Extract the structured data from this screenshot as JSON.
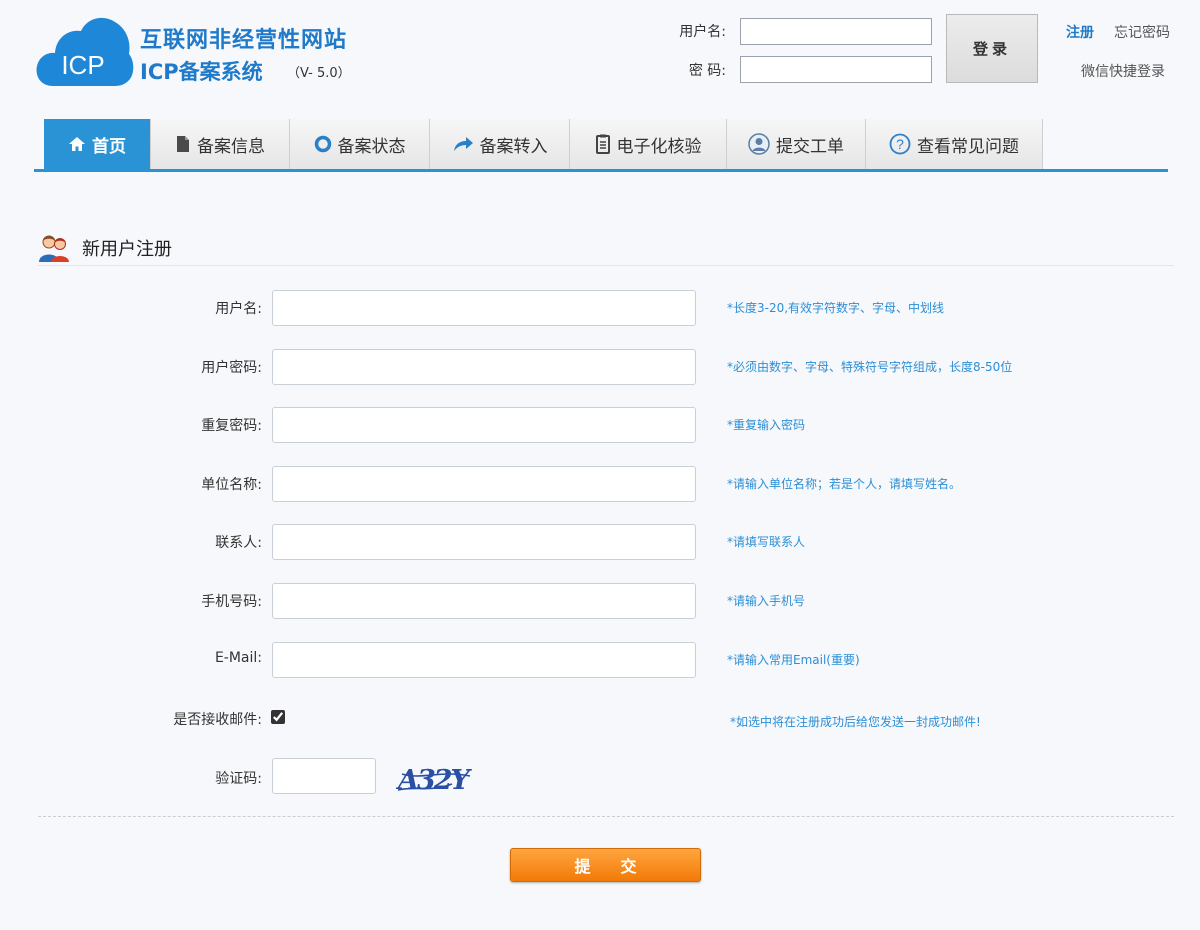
{
  "header": {
    "logo_text": "ICP",
    "title": "互联网非经营性网站",
    "subtitle": "ICP备案系统",
    "version": "（V- 5.0）",
    "username_label": "用户名:",
    "password_label": "密 码:",
    "username_value": "",
    "password_value": "",
    "login_label": "登录",
    "register_label": "注册",
    "forgot_label": "忘记密码",
    "wechat_label": "微信快捷登录"
  },
  "nav": {
    "tabs": [
      {
        "label": "首页",
        "icon": "home-icon",
        "active": true
      },
      {
        "label": "备案信息",
        "icon": "document-icon",
        "active": false
      },
      {
        "label": "备案状态",
        "icon": "ring-icon",
        "active": false
      },
      {
        "label": "备案转入",
        "icon": "arrow-right-icon",
        "active": false
      },
      {
        "label": "电子化核验",
        "icon": "clipboard-icon",
        "active": false
      },
      {
        "label": "提交工单",
        "icon": "user-icon",
        "active": false
      },
      {
        "label": "查看常见问题",
        "icon": "question-icon",
        "active": false
      }
    ]
  },
  "form": {
    "title": "新用户注册",
    "fields": [
      {
        "label": "用户名:",
        "value": "",
        "hint": "*长度3-20,有效字符数字、字母、中划线"
      },
      {
        "label": "用户密码:",
        "value": "",
        "hint": "*必须由数字、字母、特殊符号字符组成，长度8-50位"
      },
      {
        "label": "重复密码:",
        "value": "",
        "hint": "*重复输入密码"
      },
      {
        "label": "单位名称:",
        "value": "",
        "hint": "*请输入单位名称；若是个人，请填写姓名。"
      },
      {
        "label": "联系人:",
        "value": "",
        "hint": "*请填写联系人"
      },
      {
        "label": "手机号码:",
        "value": "",
        "hint": "*请输入手机号"
      },
      {
        "label": "E-Mail:",
        "value": "",
        "hint": "*请输入常用Email(重要)"
      }
    ],
    "email_option": {
      "label": "是否接收邮件:",
      "checked": true,
      "hint": "*如选中将在注册成功后给您发送一封成功邮件!"
    },
    "captcha": {
      "label": "验证码:",
      "value": "",
      "image_text": "A32Y"
    },
    "submit_label": "提交"
  },
  "colors": {
    "brand_blue": "#2a93d5",
    "title_blue": "#1f7ac9",
    "hint_blue": "#2b8fd6",
    "submit_orange": "#f78a1d"
  }
}
